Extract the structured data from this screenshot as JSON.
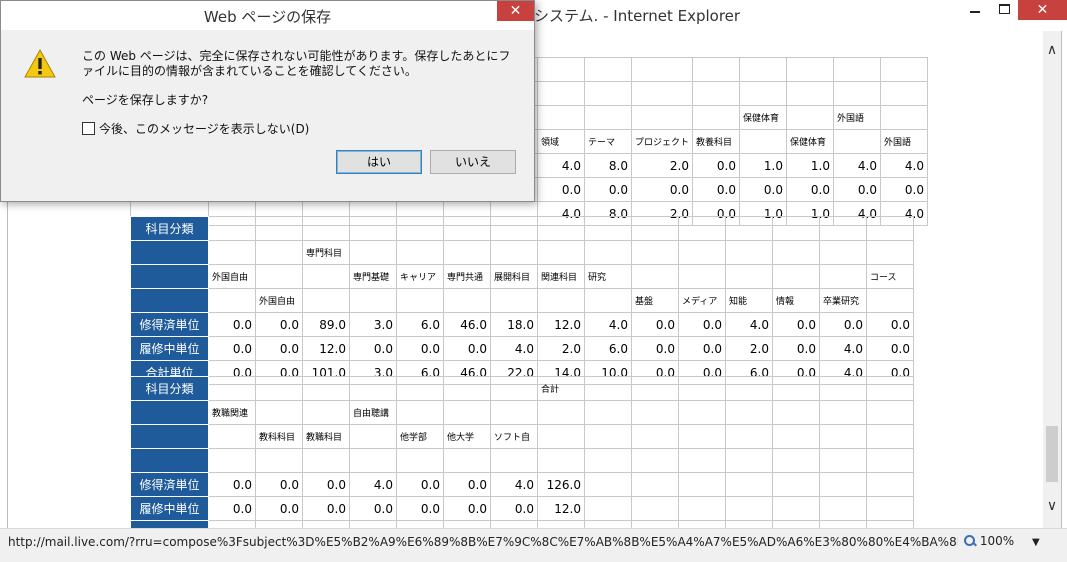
{
  "window": {
    "title": "システム. - Internet Explorer",
    "close_icon": "close-icon"
  },
  "table1": {
    "rows": [
      [
        "",
        "",
        "",
        "",
        "",
        "",
        "",
        "",
        "",
        "",
        "",
        "",
        "",
        "",
        "",
        ""
      ],
      [
        "",
        "",
        "",
        "",
        "",
        "",
        "",
        "",
        "",
        "",
        "",
        "",
        "",
        "",
        "",
        ""
      ],
      [
        "",
        "",
        "",
        "",
        "",
        "",
        "",
        "",
        "",
        "",
        "",
        "",
        "保健体育",
        "",
        "外国語",
        ""
      ],
      [
        "",
        "",
        "",
        "",
        "",
        "",
        "",
        "",
        "領域",
        "テーマ",
        "プロジェクト",
        "教養科目",
        "",
        "保健体育",
        "",
        "外国語"
      ],
      [
        "",
        "",
        "",
        "",
        "",
        "",
        "",
        "",
        "4.0",
        "8.0",
        "2.0",
        "0.0",
        "1.0",
        "1.0",
        "4.0",
        "4.0"
      ],
      [
        "",
        "",
        "",
        "",
        "",
        "",
        "",
        "",
        "0.0",
        "0.0",
        "0.0",
        "0.0",
        "0.0",
        "0.0",
        "0.0",
        "0.0"
      ],
      [
        "",
        "",
        "",
        "",
        "",
        "",
        "",
        "",
        "4.0",
        "8.0",
        "2.0",
        "0.0",
        "1.0",
        "1.0",
        "4.0",
        "4.0"
      ]
    ]
  },
  "table2": {
    "category_label": "科目分類",
    "header_rows": [
      [
        "",
        "",
        "",
        "",
        "",
        "",
        "",
        "",
        "",
        "",
        "",
        "",
        "",
        "",
        ""
      ],
      [
        "",
        "",
        "専門科目",
        "",
        "",
        "",
        "",
        "",
        "",
        "",
        "",
        "",
        "",
        "",
        ""
      ],
      [
        "外国自由",
        "",
        "",
        "専門基礎",
        "キャリア",
        "専門共通",
        "展開科目",
        "関連科目",
        "研究",
        "",
        "",
        "",
        "",
        "",
        "コース"
      ],
      [
        "",
        "外国自由",
        "",
        "",
        "",
        "",
        "",
        "",
        "",
        "基盤",
        "メディア",
        "知能",
        "情報",
        "卒業研究",
        ""
      ]
    ],
    "data_rows": [
      {
        "label": "修得済単位",
        "values": [
          "0.0",
          "0.0",
          "89.0",
          "3.0",
          "6.0",
          "46.0",
          "18.0",
          "12.0",
          "4.0",
          "0.0",
          "0.0",
          "4.0",
          "0.0",
          "0.0",
          "0.0"
        ]
      },
      {
        "label": "履修中単位",
        "values": [
          "0.0",
          "0.0",
          "12.0",
          "0.0",
          "0.0",
          "0.0",
          "4.0",
          "2.0",
          "6.0",
          "0.0",
          "0.0",
          "2.0",
          "0.0",
          "4.0",
          "0.0"
        ]
      },
      {
        "label": "合計単位",
        "values": [
          "0.0",
          "0.0",
          "101.0",
          "3.0",
          "6.0",
          "46.0",
          "22.0",
          "14.0",
          "10.0",
          "0.0",
          "0.0",
          "6.0",
          "0.0",
          "4.0",
          "0.0"
        ]
      }
    ]
  },
  "table3": {
    "category_label": "科目分類",
    "header_rows": [
      [
        "",
        "",
        "",
        "",
        "",
        "",
        "",
        "合計",
        "",
        "",
        "",
        "",
        "",
        "",
        ""
      ],
      [
        "教職関連",
        "",
        "",
        "自由聴講",
        "",
        "",
        "",
        "",
        "",
        "",
        "",
        "",
        "",
        "",
        ""
      ],
      [
        "",
        "教科科目",
        "教職科目",
        "",
        "他学部",
        "他大学",
        "ソフト自",
        "",
        "",
        "",
        "",
        "",
        "",
        "",
        ""
      ],
      [
        "",
        "",
        "",
        "",
        "",
        "",
        "",
        "",
        "",
        "",
        "",
        "",
        "",
        "",
        ""
      ]
    ],
    "data_rows": [
      {
        "label": "修得済単位",
        "values": [
          "0.0",
          "0.0",
          "0.0",
          "4.0",
          "0.0",
          "0.0",
          "4.0",
          "126.0",
          "",
          "",
          "",
          "",
          "",
          "",
          ""
        ]
      },
      {
        "label": "履修中単位",
        "values": [
          "0.0",
          "0.0",
          "0.0",
          "0.0",
          "0.0",
          "0.0",
          "0.0",
          "12.0",
          "",
          "",
          "",
          "",
          "",
          "",
          ""
        ]
      },
      {
        "label": "",
        "values": [
          "",
          "",
          "",
          "",
          "",
          "",
          "",
          "",
          "",
          "",
          "",
          "",
          "",
          "",
          ""
        ]
      }
    ]
  },
  "status": {
    "url": "http://mail.live.com/?rru=compose%3Fsubject%3D%E5%B2%A9%E6%89%8B%E7%9C%8C%E7%AB%8B%E5%A4%A7%E5%AD%A6%E3%80%80%E4%BA%8B",
    "zoom": "100%",
    "zoom_caret": "▼"
  },
  "dialog": {
    "title": "Web ページの保存",
    "message": "この Web ページは、完全に保存されない可能性があります。保存したあとにファイルに目的の情報が含まれていることを確認してください。",
    "question": "ページを保存しますか?",
    "checkbox_label": "今後、このメッセージを表示しない(D)",
    "yes_label": "はい",
    "no_label": "いいえ",
    "icon": "warning-icon"
  },
  "scrollbar": {
    "up": "∧",
    "down": "∨"
  }
}
